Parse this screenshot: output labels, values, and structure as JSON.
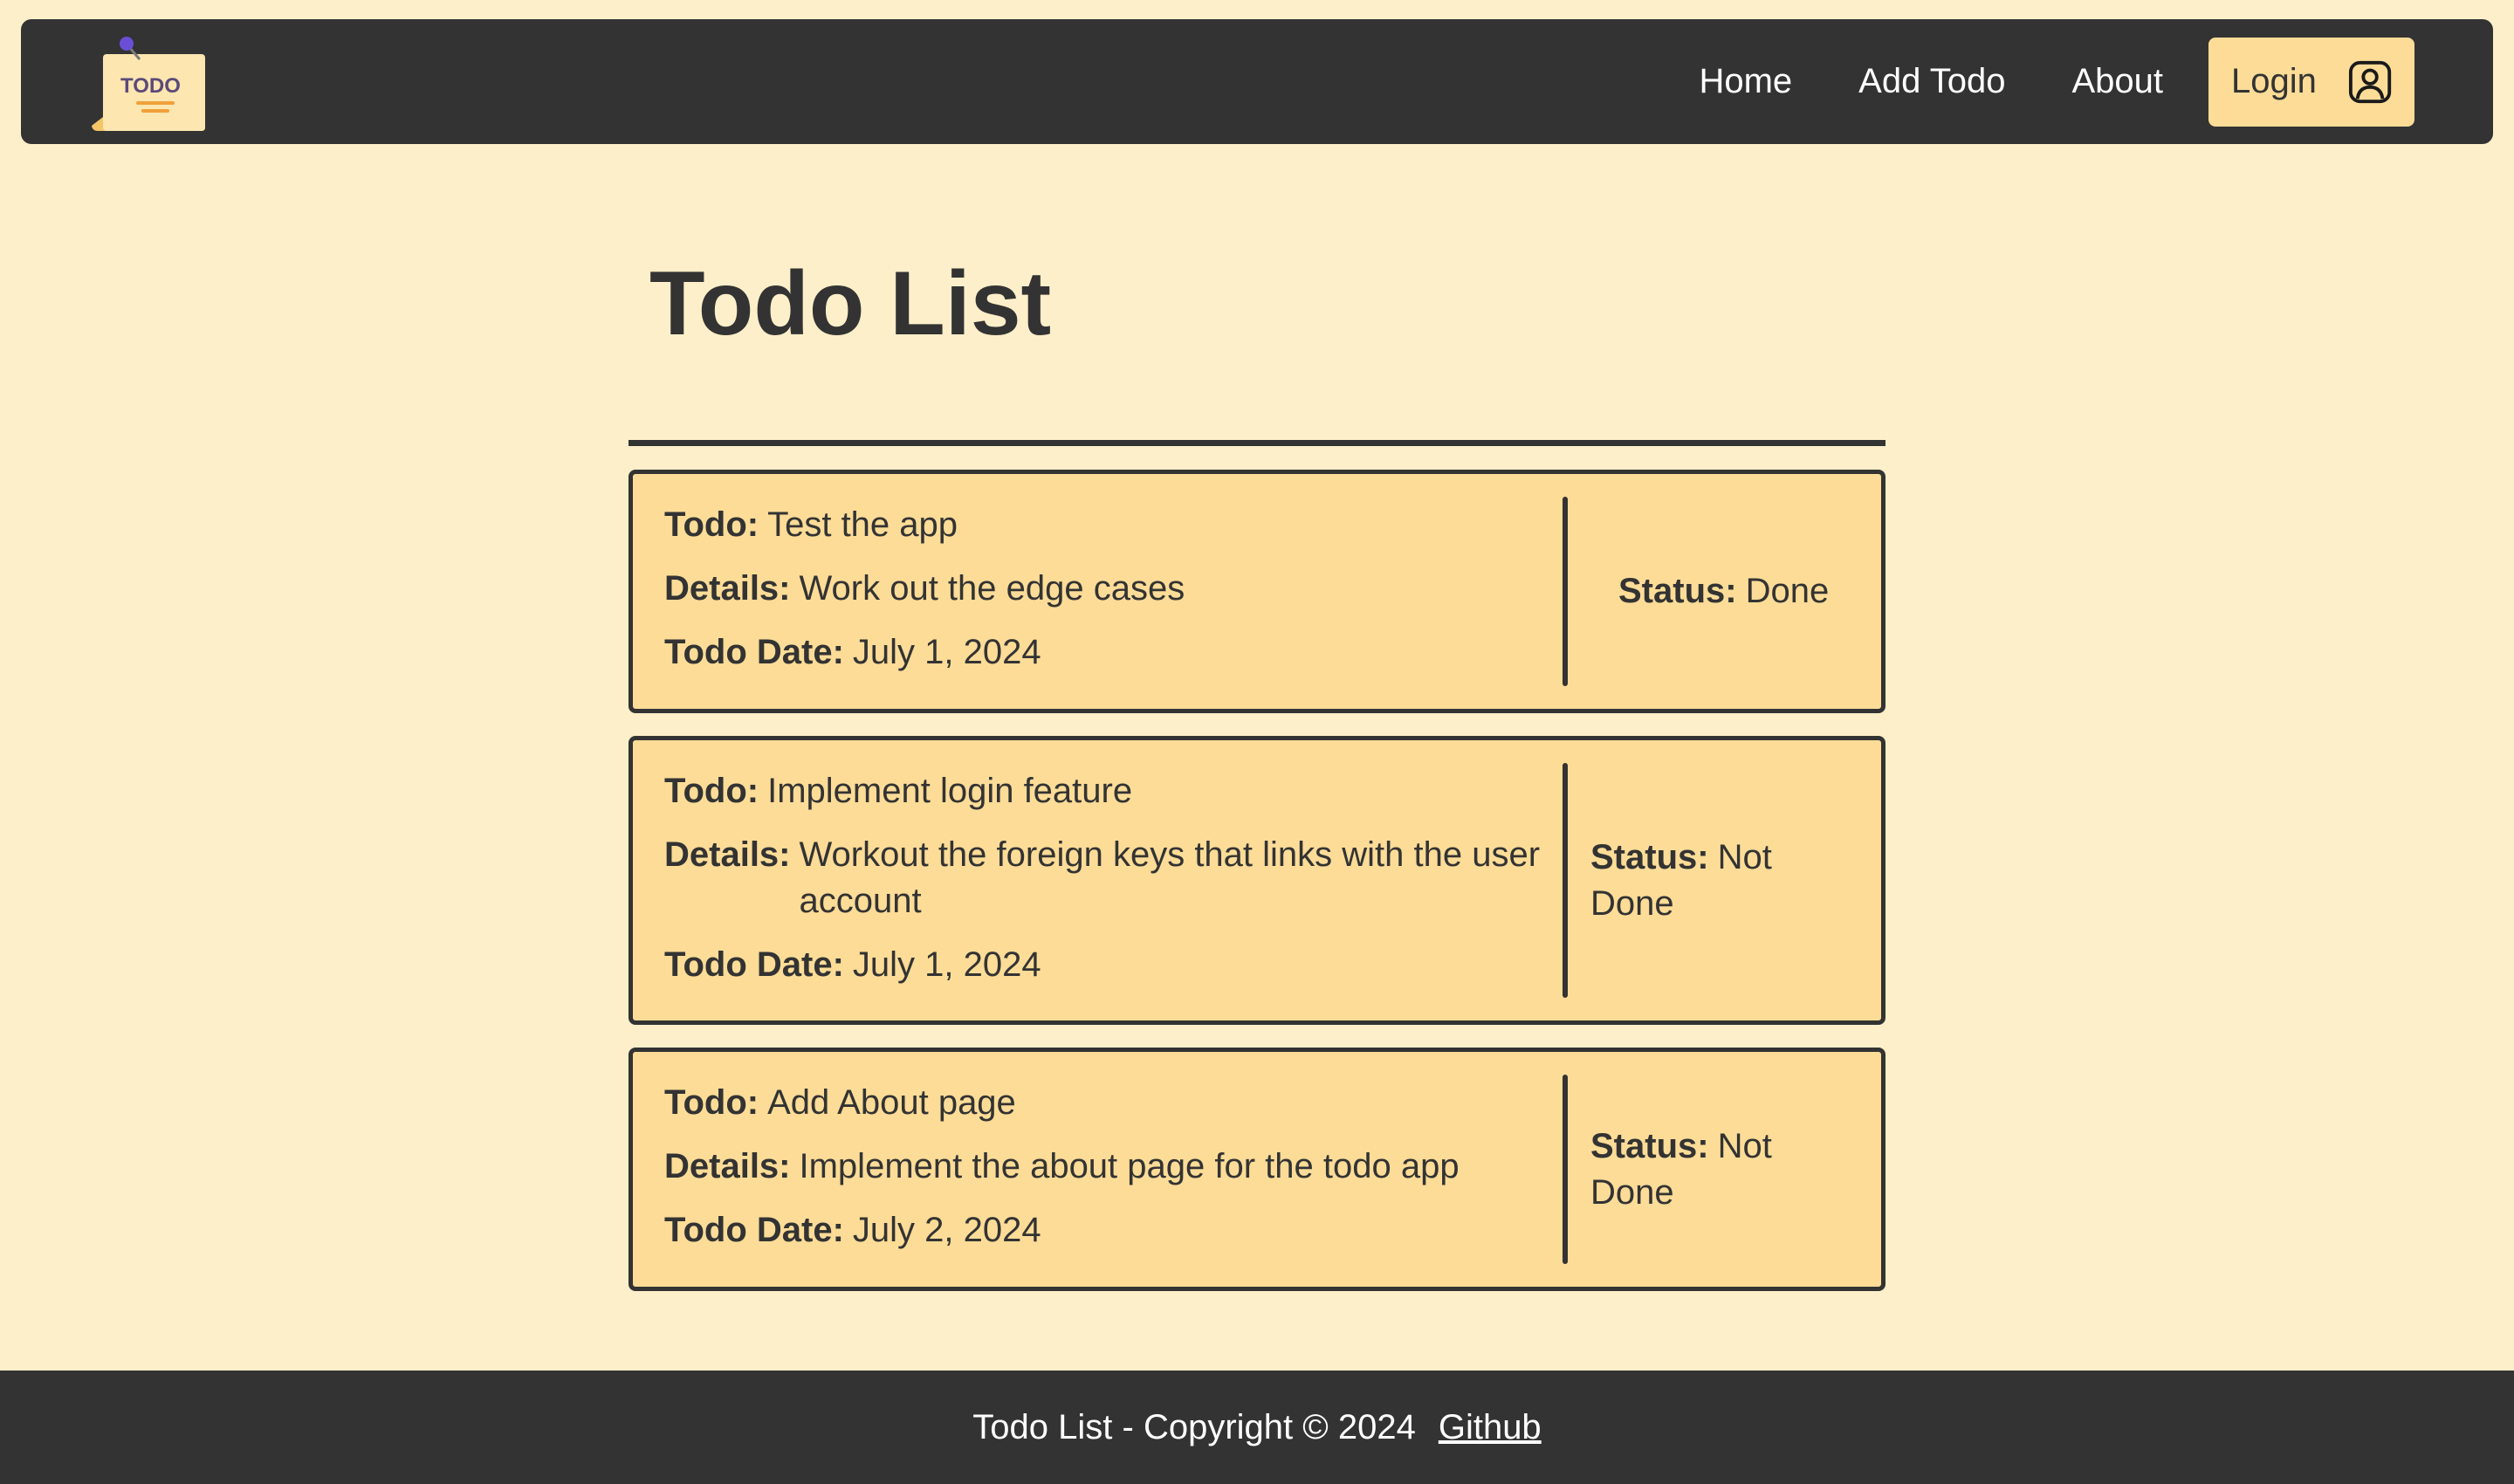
{
  "navbar": {
    "logo_text": "TODO",
    "links": [
      {
        "label": "Home"
      },
      {
        "label": "Add Todo"
      },
      {
        "label": "About"
      }
    ],
    "login_label": "Login",
    "login_icon": "user-account-icon"
  },
  "main": {
    "title": "Todo List",
    "labels": {
      "todo": "Todo:",
      "details": "Details:",
      "date": "Todo Date:",
      "status": "Status:"
    },
    "todos": [
      {
        "todo": "Test the app",
        "details": "Work out the edge cases",
        "date": "July 1, 2024",
        "status": "Done"
      },
      {
        "todo": "Implement login feature",
        "details": "Workout the foreign keys that links with the user account",
        "date": "July 1, 2024",
        "status": "Not Done"
      },
      {
        "todo": "Add About page",
        "details": "Implement the about page for the todo app",
        "date": "July 2, 2024",
        "status": "Not Done"
      }
    ]
  },
  "footer": {
    "text": "Todo List - Copyright © 2024",
    "link_label": "Github"
  },
  "colors": {
    "background": "#fdefc9",
    "dark": "#333333",
    "card": "#fcdc97"
  }
}
